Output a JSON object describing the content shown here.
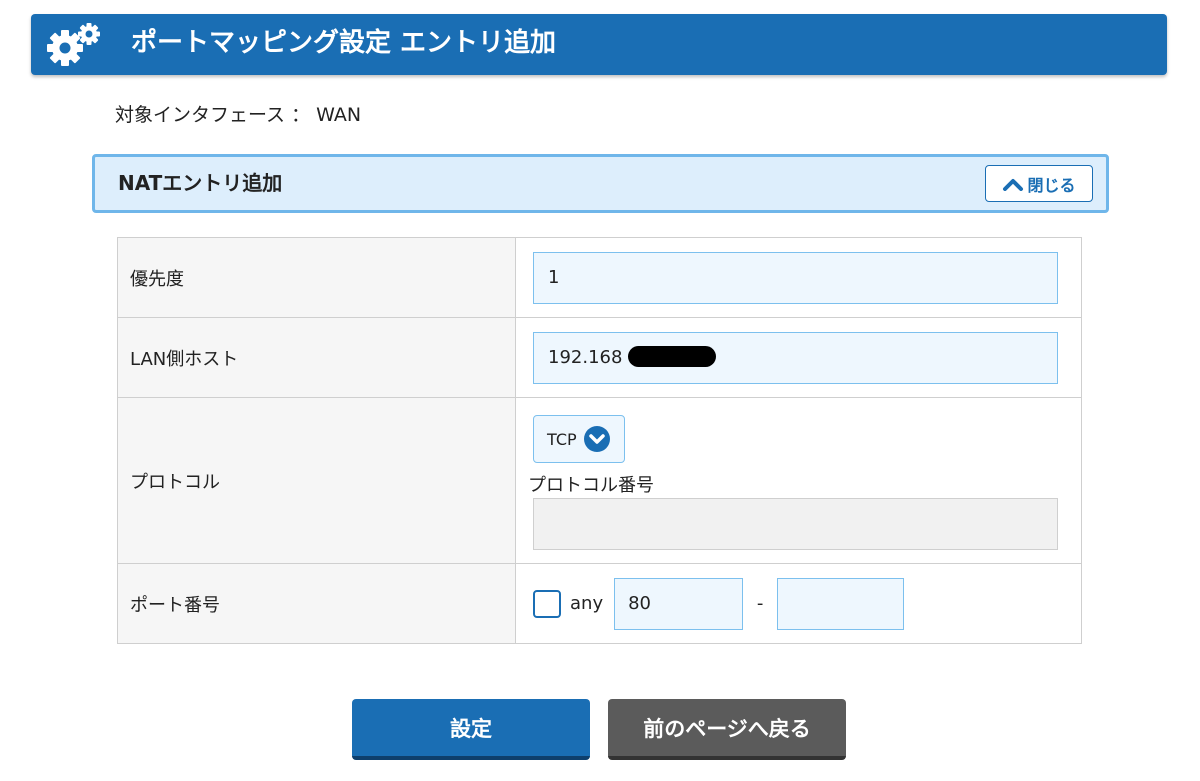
{
  "header": {
    "title": "ポートマッピング設定 エントリ追加",
    "icon": "gears-icon",
    "color": "#1a6eb4"
  },
  "interface": {
    "text": "対象インタフェース ： WAN"
  },
  "section": {
    "title": "NATエントリ追加",
    "close_label": "閉じる",
    "close_icon": "chevron-up-icon"
  },
  "form": {
    "priority": {
      "label": "優先度",
      "value": "1"
    },
    "lan_host": {
      "label": "LAN側ホスト",
      "value": "192.168"
    },
    "protocol": {
      "label": "プロトコル",
      "selected": "TCP",
      "number_label": "プロトコル番号",
      "number_value": ""
    },
    "port": {
      "label": "ポート番号",
      "any_label": "any",
      "any_checked": false,
      "from": "80",
      "separator": "-",
      "to": ""
    }
  },
  "buttons": {
    "submit_label": "設定",
    "back_label": "前のページへ戻る"
  }
}
